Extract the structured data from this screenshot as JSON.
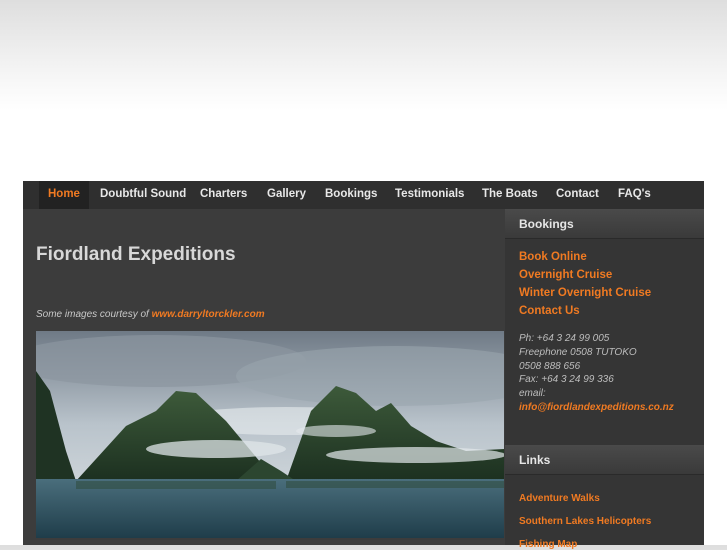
{
  "nav": [
    {
      "label": "Home",
      "active": true
    },
    {
      "label": "Doubtful Sound"
    },
    {
      "label": "Charters"
    },
    {
      "label": "Gallery"
    },
    {
      "label": "Bookings"
    },
    {
      "label": "Testimonials"
    },
    {
      "label": "The Boats"
    },
    {
      "label": "Contact"
    },
    {
      "label": "FAQ's"
    }
  ],
  "main": {
    "title": "Fiordland Expeditions",
    "credit_prefix": "Some images courtesy of",
    "credit_link": "www.darryltorckler.com"
  },
  "sidebar": {
    "bookings_heading": "Bookings",
    "booking_links": [
      "Book Online",
      "Overnight Cruise",
      "Winter Overnight Cruise",
      "Contact Us"
    ],
    "contact": {
      "phone": "Ph: +64 3 24 99 005",
      "freephone": "Freephone 0508 TUTOKO",
      "freephone_num": "0508 888 656",
      "fax": "Fax: +64 3 24 99 336",
      "email_label": "email:",
      "email": "info@fiordlandexpeditions.co.nz"
    },
    "links_heading": "Links",
    "links": [
      "Adventure Walks",
      "Southern Lakes Helicopters",
      "Fishing Map"
    ]
  },
  "colors": {
    "accent": "#f07a22",
    "panel": "#3c3c3c",
    "nav": "#2f2f2f"
  }
}
